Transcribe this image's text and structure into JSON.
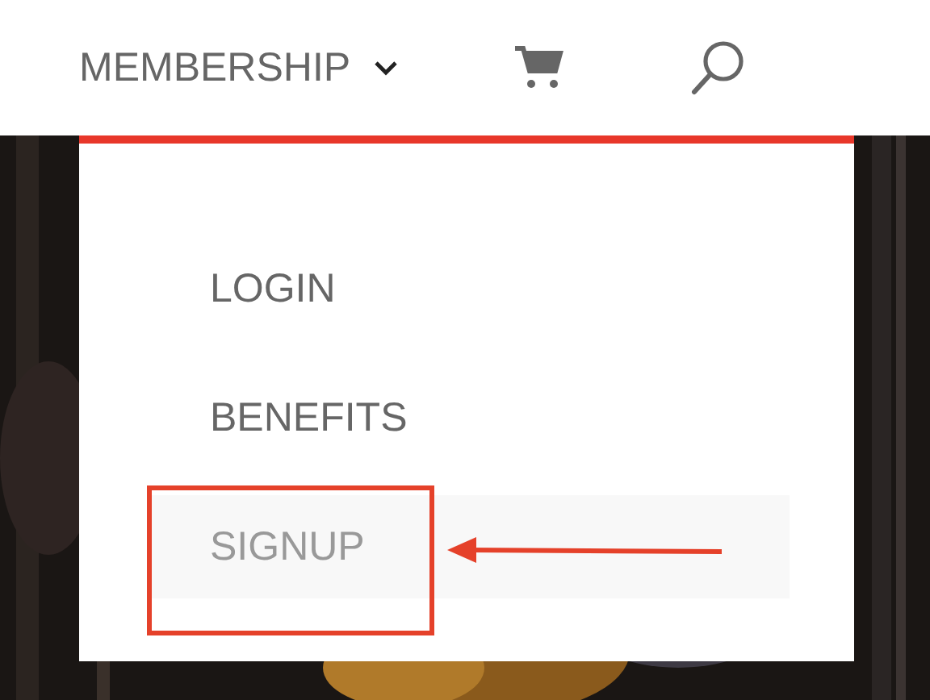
{
  "nav": {
    "label": "MEMBERSHIP",
    "expanded": true
  },
  "dropdown": {
    "items": [
      {
        "label": "LOGIN",
        "selected": false
      },
      {
        "label": "BENEFITS",
        "selected": false
      },
      {
        "label": "SIGNUP",
        "selected": true
      }
    ]
  }
}
